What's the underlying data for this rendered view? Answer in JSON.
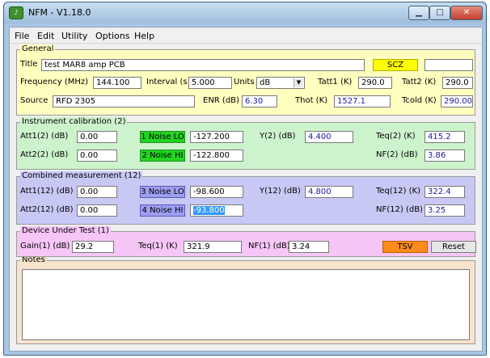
{
  "window": {
    "title": "NFM - V1.18.0",
    "icon": "nfm-app-icon"
  },
  "menu": [
    "File",
    "Edit",
    "Utility",
    "Options",
    "Help"
  ],
  "general": {
    "legend": "General",
    "title_label": "Title",
    "title_value": "test MAR8 amp  PCB",
    "scz_label": "SCZ",
    "extra_value": "",
    "frequency_label": "Frequency (MHz)",
    "frequency_value": "144.100",
    "interval_label": "Interval (s)",
    "interval_value": "5.000",
    "units_label": "Units",
    "units_value": "dB",
    "tatt1_label": "Tatt1 (K)",
    "tatt1_value": "290.0",
    "tatt2_label": "Tatt2 (K)",
    "tatt2_value": "290.0",
    "source_label": "Source",
    "source_value": "RFD 2305",
    "enr_label": "ENR (dB)",
    "enr_value": "6.30",
    "thot_label": "Thot (K)",
    "thot_value": "1527.1",
    "tcold_label": "Tcold (K)",
    "tcold_value": "290.00"
  },
  "instrument": {
    "legend": "Instrument calibration (2)",
    "att1_label": "Att1(2) (dB)",
    "att1_value": "0.00",
    "att2_label": "Att2(2) (dB)",
    "att2_value": "0.00",
    "noise_lo_label": "1 Noise LO",
    "noise_lo_value": "-127.200",
    "noise_hi_label": "2 Noise HI",
    "noise_hi_value": "-122.800",
    "y_label": "Y(2) (dB)",
    "y_value": "4.400",
    "teq_label": "Teq(2) (K)",
    "teq_value": "415.2",
    "nf_label": "NF(2) (dB)",
    "nf_value": "3.86"
  },
  "combined": {
    "legend": "Combined measurement (12)",
    "att1_label": "Att1(12) (dB)",
    "att1_value": "0.00",
    "att2_label": "Att2(12) (dB)",
    "att2_value": "0.00",
    "noise_lo_label": "3 Noise LO",
    "noise_lo_value": "-98.600",
    "noise_hi_label": "4 Noise HI",
    "noise_hi_value": "-93.800",
    "y_label": "Y(12) (dB)",
    "y_value": "4.800",
    "teq_label": "Teq(12) (K)",
    "teq_value": "322.4",
    "nf_label": "NF(12) (dB)",
    "nf_value": "3.25"
  },
  "dut": {
    "legend": "Device Under Test (1)",
    "gain_label": "Gain(1) (dB)",
    "gain_value": "29.2",
    "teq_label": "Teq(1) (K)",
    "teq_value": "321.9",
    "nf_label": "NF(1) (dB)",
    "nf_value": "3.24",
    "tsv_label": "TSV",
    "reset_label": "Reset"
  },
  "notes": {
    "legend": "Notes",
    "value": ""
  },
  "colors": {
    "general_bg": "#ffffc0",
    "instrument_bg": "#cdf3cd",
    "combined_bg": "#c8c8f5",
    "dut_bg": "#f6c6f6",
    "notes_bg": "#f8e4cc"
  }
}
